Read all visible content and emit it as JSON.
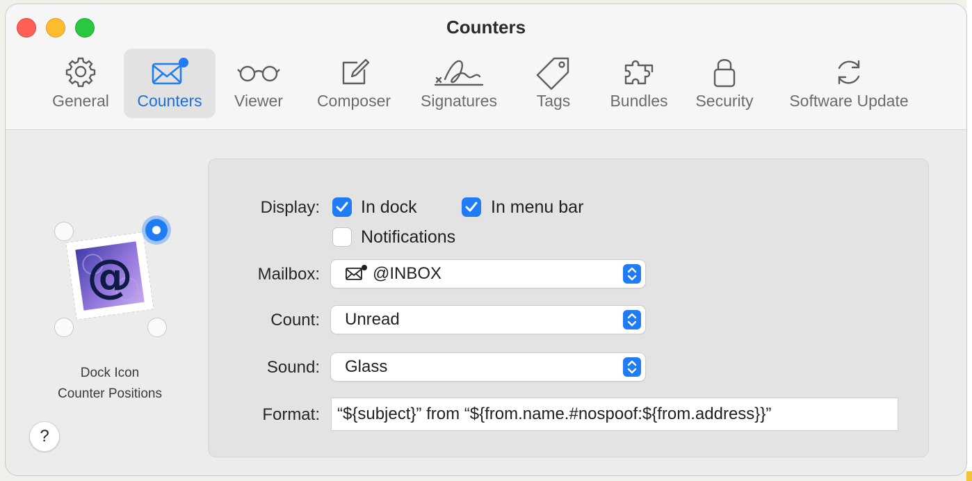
{
  "window": {
    "title": "Counters"
  },
  "tabs": [
    {
      "label": "General",
      "icon": "gear-icon"
    },
    {
      "label": "Counters",
      "icon": "envelope-badge-icon",
      "active": true
    },
    {
      "label": "Viewer",
      "icon": "glasses-icon"
    },
    {
      "label": "Composer",
      "icon": "compose-icon"
    },
    {
      "label": "Signatures",
      "icon": "signature-icon"
    },
    {
      "label": "Tags",
      "icon": "tag-icon"
    },
    {
      "label": "Bundles",
      "icon": "puzzle-icon"
    },
    {
      "label": "Security",
      "icon": "lock-icon"
    },
    {
      "label": "Software Update",
      "icon": "refresh-icon"
    }
  ],
  "dock": {
    "caption_line1": "Dock Icon",
    "caption_line2": "Counter Positions",
    "selected_position": "top-right",
    "stamp_glyph": "@"
  },
  "help": {
    "label": "?"
  },
  "form": {
    "display_label": "Display:",
    "in_dock_label": "In dock",
    "in_dock_checked": true,
    "in_menu_bar_label": "In menu bar",
    "in_menu_bar_checked": true,
    "notifications_label": "Notifications",
    "notifications_checked": false,
    "mailbox_label": "Mailbox:",
    "mailbox_value": "@INBOX",
    "count_label": "Count:",
    "count_value": "Unread",
    "sound_label": "Sound:",
    "sound_value": "Glass",
    "format_label": "Format:",
    "format_value": "“${subject}” from “${from.name.#nospoof:${from.address}}”"
  },
  "colors": {
    "accent": "#1f7cf5",
    "active_tab_text": "#1a6fdc",
    "close": "#fe5f57",
    "minimize": "#febc2e",
    "maximize": "#28c840"
  }
}
